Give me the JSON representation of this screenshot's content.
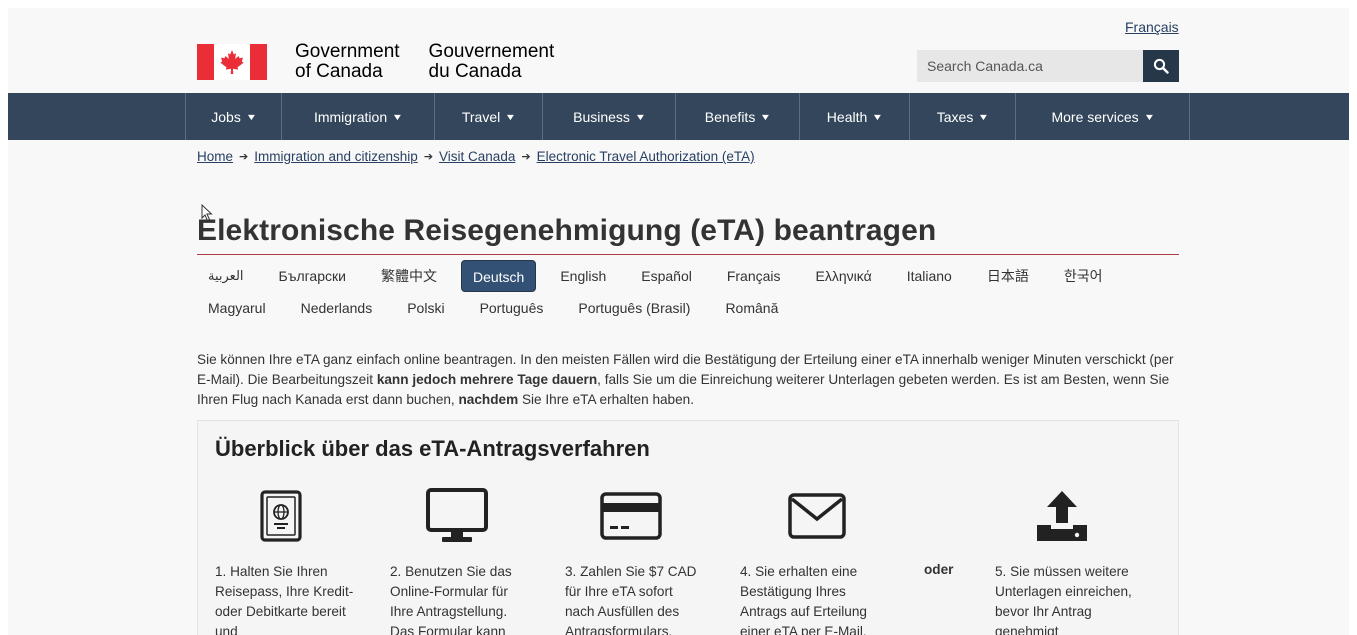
{
  "header": {
    "language_toggle": "Français",
    "wordmark_en_line1": "Government",
    "wordmark_en_line2": "of Canada",
    "wordmark_fr_line1": "Gouvernement",
    "wordmark_fr_line2": "du Canada",
    "search_placeholder": "Search Canada.ca",
    "search_icon": "magnifier-icon"
  },
  "menu": {
    "items": [
      {
        "label": "Jobs"
      },
      {
        "label": "Immigration"
      },
      {
        "label": "Travel"
      },
      {
        "label": "Business"
      },
      {
        "label": "Benefits"
      },
      {
        "label": "Health"
      },
      {
        "label": "Taxes"
      },
      {
        "label": "More services"
      }
    ],
    "chevron_icon": "chevron-down-icon"
  },
  "breadcrumb": [
    "Home",
    "Immigration and citizenship",
    "Visit Canada",
    "Electronic Travel Authorization (eTA)"
  ],
  "page_title": "Elektronische Reisegenehmigung (eTA) beantragen",
  "languages": {
    "row1": [
      "العربية",
      "Български",
      "繁體中文",
      "Deutsch",
      "English",
      "Español",
      "Français",
      "Ελληνικά",
      "Italiano",
      "日本語",
      "한국어"
    ],
    "row2": [
      "Magyarul",
      "Nederlands",
      "Polski",
      "Português",
      "Português (Brasil)",
      "Română"
    ],
    "active": "Deutsch"
  },
  "intro": {
    "part1": "Sie können Ihre eTA ganz einfach online beantragen. In den meisten Fällen wird die Bestätigung der Erteilung einer eTA innerhalb weniger Minuten verschickt (per E-Mail). Die Bearbeitungszeit ",
    "bold1": "kann jedoch mehrere Tage dauern",
    "part2": ", falls Sie um die Einreichung weiterer Unterlagen gebeten werden. Es ist am Besten, wenn Sie Ihren Flug nach Kanada erst dann buchen, ",
    "bold2": "nachdem",
    "part3": " Sie Ihre eTA erhalten haben."
  },
  "overview": {
    "heading": "Überblick über das eTA-Antragsverfahren",
    "or_label": "oder",
    "steps": [
      {
        "icon": "passport-icon",
        "text": "1. Halten Sie Ihren Reisepass, Ihre Kredit- oder Debitkarte bereit und"
      },
      {
        "icon": "monitor-icon",
        "text": "2. Benutzen Sie das Online-Formular für Ihre Antragstellung. Das Formular kann"
      },
      {
        "icon": "credit-card-icon",
        "text": "3. Zahlen Sie $7 CAD für Ihre eTA sofort nach Ausfüllen des Antragsformulars."
      },
      {
        "icon": "envelope-icon",
        "text": "4. Sie erhalten eine Bestätigung Ihres Antrags auf Erteilung einer eTA per E-Mail. In"
      },
      {
        "icon": "upload-icon",
        "text": "5. Sie müssen weitere Unterlagen einreichen, bevor Ihr Antrag genehmigt"
      }
    ]
  },
  "colors": {
    "nav_bg": "#33465c",
    "link": "#284162",
    "active_lang": "#335075",
    "flag_red": "#eb2d37",
    "title_rule": "#af3c43"
  }
}
